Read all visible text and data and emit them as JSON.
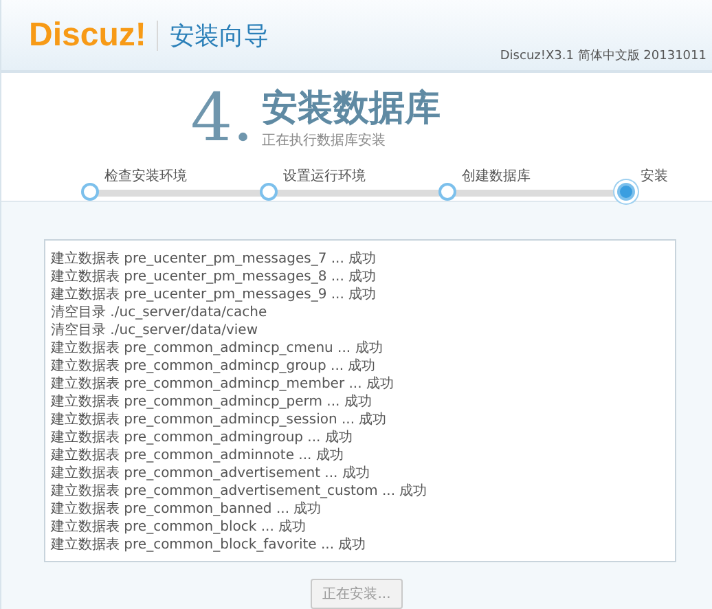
{
  "header": {
    "logo": "Discuz!",
    "title": "安装向导",
    "version": "Discuz!X3.1 简体中文版 20131011"
  },
  "step_heading": {
    "number": "4.",
    "title": "安装数据库",
    "subtitle": "正在执行数据库安装"
  },
  "steps": [
    {
      "label": "检查安装环境",
      "selected": false
    },
    {
      "label": "设置运行环境",
      "selected": false
    },
    {
      "label": "创建数据库",
      "selected": false
    },
    {
      "label": "安装",
      "selected": true
    }
  ],
  "log": [
    "建立数据表 pre_ucenter_pm_messages_7 ... 成功",
    "建立数据表 pre_ucenter_pm_messages_8 ... 成功",
    "建立数据表 pre_ucenter_pm_messages_9 ... 成功",
    "清空目录 ./uc_server/data/cache",
    "清空目录 ./uc_server/data/view",
    "建立数据表 pre_common_admincp_cmenu ... 成功",
    "建立数据表 pre_common_admincp_group ... 成功",
    "建立数据表 pre_common_admincp_member ... 成功",
    "建立数据表 pre_common_admincp_perm ... 成功",
    "建立数据表 pre_common_admincp_session ... 成功",
    "建立数据表 pre_common_admingroup ... 成功",
    "建立数据表 pre_common_adminnote ... 成功",
    "建立数据表 pre_common_advertisement ... 成功",
    "建立数据表 pre_common_advertisement_custom ... 成功",
    "建立数据表 pre_common_banned ... 成功",
    "建立数据表 pre_common_block ... 成功",
    "建立数据表 pre_common_block_favorite ... 成功"
  ],
  "button": {
    "label": "正在安装...",
    "disabled": true
  }
}
